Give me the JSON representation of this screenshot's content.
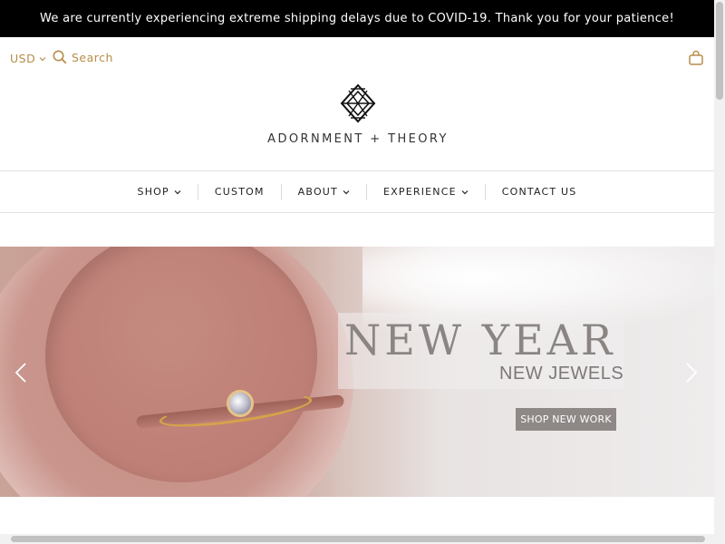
{
  "announcement": {
    "text": "We are currently experiencing extreme shipping delays due to COVID-19. Thank you for your patience!"
  },
  "header": {
    "currency": "USD",
    "search_label": "Search",
    "brand": "ADORNMENT + THEORY",
    "accent_color": "#b88d4b"
  },
  "nav": {
    "items": [
      {
        "label": "SHOP",
        "has_dropdown": true
      },
      {
        "label": "CUSTOM",
        "has_dropdown": false
      },
      {
        "label": "ABOUT",
        "has_dropdown": true
      },
      {
        "label": "EXPERIENCE",
        "has_dropdown": true
      },
      {
        "label": "CONTACT US",
        "has_dropdown": false
      }
    ]
  },
  "hero": {
    "title": "NEW YEAR",
    "subtitle": "NEW JEWELS",
    "cta_label": "SHOP NEW WORK",
    "prev_icon": "chevron-left-icon",
    "next_icon": "chevron-right-icon"
  }
}
